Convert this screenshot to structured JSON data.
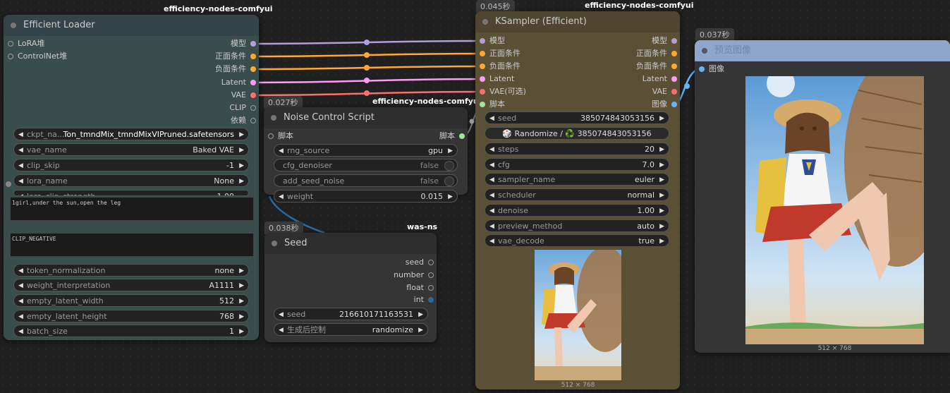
{
  "colors": {
    "model": "#b39ddb",
    "conditioning": "#ffa931",
    "latent": "#ff9cf9",
    "vae": "#ff6e6e",
    "clip": "#ffd500",
    "image": "#64b5f6",
    "script": "#a1e29c",
    "int": "#29699c"
  },
  "loader": {
    "source": "efficiency-nodes-comfyui",
    "title": "Efficient Loader",
    "inputs": [
      "LoRA堆",
      "ControlNet堆"
    ],
    "outputs": [
      "模型",
      "正面条件",
      "负面条件",
      "Latent",
      "VAE",
      "CLIP",
      "依赖"
    ],
    "widgets": [
      {
        "label": "ckpt_na...",
        "value": "Ton_tmndMix_tmndMixVIPruned.safetensors"
      },
      {
        "label": "vae_name",
        "value": "Baked VAE"
      },
      {
        "label": "clip_skip",
        "value": "-1"
      },
      {
        "label": "lora_name",
        "value": "None"
      },
      {
        "label": "lora_clip_strength",
        "value": "1.00"
      }
    ],
    "positive_text": "1girl,under the sun,open the leg",
    "negative_text": "CLIP_NEGATIVE",
    "widgets2": [
      {
        "label": "token_normalization",
        "value": "none"
      },
      {
        "label": "weight_interpretation",
        "value": "A1111"
      },
      {
        "label": "empty_latent_width",
        "value": "512"
      },
      {
        "label": "empty_latent_height",
        "value": "768"
      },
      {
        "label": "batch_size",
        "value": "1"
      }
    ]
  },
  "noise": {
    "time": "0.027秒",
    "source": "efficiency-nodes-comfyui",
    "title": "Noise Control Script",
    "input": "脚本",
    "output": "脚本",
    "widgets": [
      {
        "label": "rng_source",
        "value": "gpu",
        "kind": "combo"
      },
      {
        "label": "cfg_denoiser",
        "value": "false",
        "kind": "toggle"
      },
      {
        "label": "add_seed_noise",
        "value": "false",
        "kind": "toggle"
      },
      {
        "label": "weight",
        "value": "0.015",
        "kind": "combo"
      }
    ]
  },
  "seed": {
    "time": "0.038秒",
    "source": "was-ns",
    "title": "Seed",
    "outputs": [
      "seed",
      "number",
      "float",
      "int"
    ],
    "widgets": [
      {
        "label": "seed",
        "value": "216610171163531"
      },
      {
        "label": "生成后控制",
        "value": "randomize"
      }
    ]
  },
  "ksampler": {
    "time": "0.045秒",
    "source": "efficiency-nodes-comfyui",
    "title": "KSampler (Efficient)",
    "inputs": [
      "模型",
      "正面条件",
      "负面条件",
      "Latent",
      "VAE(可选)",
      "脚本"
    ],
    "outputs": [
      "模型",
      "正面条件",
      "负面条件",
      "Latent",
      "VAE",
      "图像"
    ],
    "seed_label": "seed",
    "seed_value": "385074843053156",
    "randomize_text": "Randomize / ♻️ 385074843053156",
    "widgets": [
      {
        "label": "steps",
        "value": "20"
      },
      {
        "label": "cfg",
        "value": "7.0"
      },
      {
        "label": "sampler_name",
        "value": "euler"
      },
      {
        "label": "scheduler",
        "value": "normal"
      },
      {
        "label": "denoise",
        "value": "1.00"
      },
      {
        "label": "preview_method",
        "value": "auto"
      },
      {
        "label": "vae_decode",
        "value": "true"
      }
    ],
    "image_caption": "512 × 768"
  },
  "preview": {
    "time": "0.037秒",
    "title": "预览图像",
    "input": "图像",
    "image_caption": "512 × 768"
  }
}
